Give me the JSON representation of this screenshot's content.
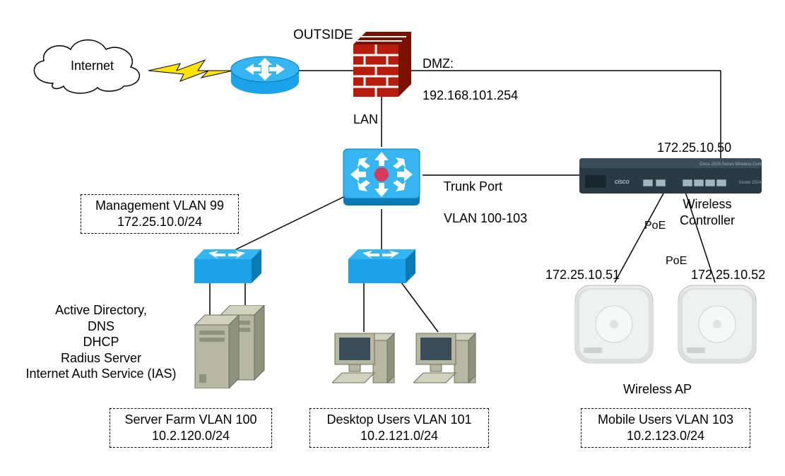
{
  "labels": {
    "internet": "Internet",
    "outside": "OUTSIDE",
    "dmz_title": "DMZ:",
    "dmz_ip": "192.168.101.254",
    "lan": "LAN",
    "wlc_ip": "172.25.10.50",
    "trunk_port": "Trunk Port",
    "trunk_vlans": "VLAN 100-103",
    "wireless_controller": "Wireless\nController",
    "poe1": "PoE",
    "poe2": "PoE",
    "ap1_ip": "172.25.10.51",
    "ap2_ip": "172.25.10.52",
    "wireless_ap": "Wireless AP",
    "server_services": "Active Directory,\nDNS\nDHCP\nRadius Server\nInternet Auth Service (IAS)"
  },
  "boxes": {
    "mgmt": {
      "line1": "Management VLAN 99",
      "line2": "172.25.10.0/24"
    },
    "server_farm": {
      "line1": "Server Farm VLAN 100",
      "line2": "10.2.120.0/24"
    },
    "desktop": {
      "line1": "Desktop Users VLAN 101",
      "line2": "10.2.121.0/24"
    },
    "mobile": {
      "line1": "Mobile Users VLAN 103",
      "line2": "10.2.123.0/24"
    }
  }
}
